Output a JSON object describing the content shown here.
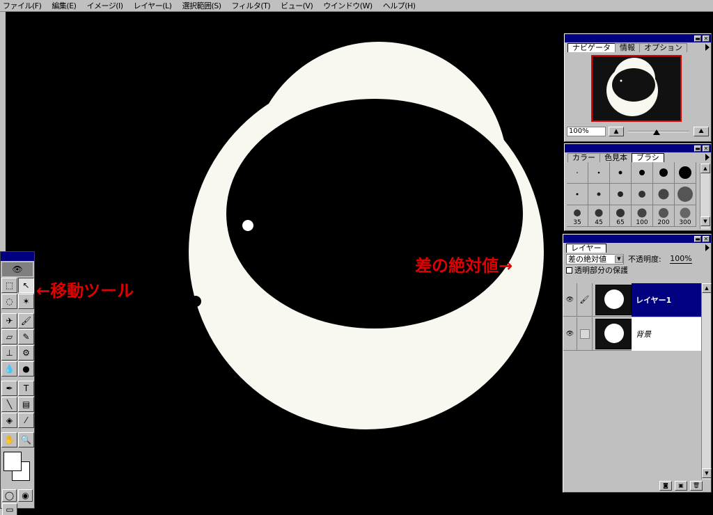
{
  "menu": [
    "ファイル(F)",
    "編集(E)",
    "イメージ(I)",
    "レイヤー(L)",
    "選択範囲(S)",
    "フィルタ(T)",
    "ビュー(V)",
    "ウインドウ(W)",
    "ヘルプ(H)"
  ],
  "navigator": {
    "tabs": [
      "ナビゲータ",
      "情報",
      "オプション"
    ],
    "zoom": "100%"
  },
  "brushes": {
    "tabs": [
      "カラー",
      "色見本",
      "ブラシ"
    ],
    "size_labels": [
      "35",
      "45",
      "65",
      "100",
      "200",
      "300"
    ]
  },
  "layers": {
    "tab": "レイヤー",
    "blend_mode": "差の絶対値",
    "opacity_label": "不透明度:",
    "opacity_value": "100%",
    "preserve_label": "透明部分の保護",
    "items": [
      {
        "name": "レイヤー1",
        "selected": true
      },
      {
        "name": "背景",
        "selected": false
      }
    ]
  },
  "annotations": {
    "move_tool": "←移動ツール",
    "blend_mode": "差の絶対値→"
  },
  "colors": {
    "accent_annotation": "#e00000",
    "selection": "#000080",
    "circle_fill": "#f8f8f0",
    "ui_gray": "#c0c0c0"
  }
}
